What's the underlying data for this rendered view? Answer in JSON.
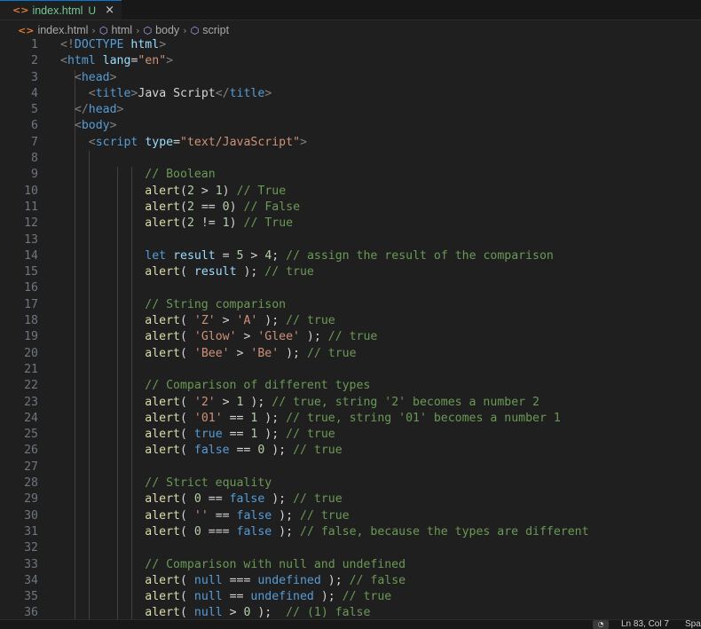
{
  "tab": {
    "icon": "html-file-icon",
    "name": "index.html",
    "status": "U",
    "close": "×"
  },
  "breadcrumbs": [
    "index.html",
    "html",
    "body",
    "script"
  ],
  "editor": {
    "lines": [
      [
        [
          "br",
          "<!"
        ],
        [
          "tag",
          "DOCTYPE"
        ],
        [
          "txt",
          " "
        ],
        [
          "attr",
          "html"
        ],
        [
          "br",
          ">"
        ]
      ],
      [
        [
          "br",
          "<"
        ],
        [
          "tag",
          "html"
        ],
        [
          "txt",
          " "
        ],
        [
          "attr",
          "lang"
        ],
        [
          "txt",
          "="
        ],
        [
          "str",
          "\"en\""
        ],
        [
          "br",
          ">"
        ]
      ],
      [
        [
          "txt",
          "  "
        ],
        [
          "br",
          "<"
        ],
        [
          "tag",
          "head"
        ],
        [
          "br",
          ">"
        ]
      ],
      [
        [
          "txt",
          "    "
        ],
        [
          "br",
          "<"
        ],
        [
          "tag",
          "title"
        ],
        [
          "br",
          ">"
        ],
        [
          "txt",
          "Java Script"
        ],
        [
          "br",
          "</"
        ],
        [
          "tag",
          "title"
        ],
        [
          "br",
          ">"
        ]
      ],
      [
        [
          "txt",
          "  "
        ],
        [
          "br",
          "</"
        ],
        [
          "tag",
          "head"
        ],
        [
          "br",
          ">"
        ]
      ],
      [
        [
          "txt",
          "  "
        ],
        [
          "br",
          "<"
        ],
        [
          "tag",
          "body"
        ],
        [
          "br",
          ">"
        ]
      ],
      [
        [
          "txt",
          "    "
        ],
        [
          "br",
          "<"
        ],
        [
          "tag",
          "script"
        ],
        [
          "txt",
          " "
        ],
        [
          "attr",
          "type"
        ],
        [
          "txt",
          "="
        ],
        [
          "str",
          "\"text/JavaScript\""
        ],
        [
          "br",
          ">"
        ]
      ],
      [],
      [
        [
          "txt",
          "            "
        ],
        [
          "cm",
          "// Boolean"
        ]
      ],
      [
        [
          "txt",
          "            "
        ],
        [
          "fn",
          "alert"
        ],
        [
          "txt",
          "("
        ],
        [
          "num",
          "2"
        ],
        [
          "txt",
          " > "
        ],
        [
          "num",
          "1"
        ],
        [
          "txt",
          ") "
        ],
        [
          "cm",
          "// True"
        ]
      ],
      [
        [
          "txt",
          "            "
        ],
        [
          "fn",
          "alert"
        ],
        [
          "txt",
          "("
        ],
        [
          "num",
          "2"
        ],
        [
          "txt",
          " == "
        ],
        [
          "num",
          "0"
        ],
        [
          "txt",
          ") "
        ],
        [
          "cm",
          "// False"
        ]
      ],
      [
        [
          "txt",
          "            "
        ],
        [
          "fn",
          "alert"
        ],
        [
          "txt",
          "("
        ],
        [
          "num",
          "2"
        ],
        [
          "txt",
          " != "
        ],
        [
          "num",
          "1"
        ],
        [
          "txt",
          ") "
        ],
        [
          "cm",
          "// True"
        ]
      ],
      [],
      [
        [
          "txt",
          "            "
        ],
        [
          "kw",
          "let"
        ],
        [
          "txt",
          " "
        ],
        [
          "var",
          "result"
        ],
        [
          "txt",
          " = "
        ],
        [
          "num",
          "5"
        ],
        [
          "txt",
          " > "
        ],
        [
          "num",
          "4"
        ],
        [
          "txt",
          "; "
        ],
        [
          "cm",
          "// assign the result of the comparison"
        ]
      ],
      [
        [
          "txt",
          "            "
        ],
        [
          "fn",
          "alert"
        ],
        [
          "txt",
          "( "
        ],
        [
          "var",
          "result"
        ],
        [
          "txt",
          " ); "
        ],
        [
          "cm",
          "// true"
        ]
      ],
      [],
      [
        [
          "txt",
          "            "
        ],
        [
          "cm",
          "// String comparison"
        ]
      ],
      [
        [
          "txt",
          "            "
        ],
        [
          "fn",
          "alert"
        ],
        [
          "txt",
          "( "
        ],
        [
          "str",
          "'Z'"
        ],
        [
          "txt",
          " > "
        ],
        [
          "str",
          "'A'"
        ],
        [
          "txt",
          " ); "
        ],
        [
          "cm",
          "// true"
        ]
      ],
      [
        [
          "txt",
          "            "
        ],
        [
          "fn",
          "alert"
        ],
        [
          "txt",
          "( "
        ],
        [
          "str",
          "'Glow'"
        ],
        [
          "txt",
          " > "
        ],
        [
          "str",
          "'Glee'"
        ],
        [
          "txt",
          " ); "
        ],
        [
          "cm",
          "// true"
        ]
      ],
      [
        [
          "txt",
          "            "
        ],
        [
          "fn",
          "alert"
        ],
        [
          "txt",
          "( "
        ],
        [
          "str",
          "'Bee'"
        ],
        [
          "txt",
          " > "
        ],
        [
          "str",
          "'Be'"
        ],
        [
          "txt",
          " ); "
        ],
        [
          "cm",
          "// true"
        ]
      ],
      [],
      [
        [
          "txt",
          "            "
        ],
        [
          "cm",
          "// Comparison of different types"
        ]
      ],
      [
        [
          "txt",
          "            "
        ],
        [
          "fn",
          "alert"
        ],
        [
          "txt",
          "( "
        ],
        [
          "str",
          "'2'"
        ],
        [
          "txt",
          " > "
        ],
        [
          "num",
          "1"
        ],
        [
          "txt",
          " ); "
        ],
        [
          "cm",
          "// true, string '2' becomes a number 2"
        ]
      ],
      [
        [
          "txt",
          "            "
        ],
        [
          "fn",
          "alert"
        ],
        [
          "txt",
          "( "
        ],
        [
          "str",
          "'01'"
        ],
        [
          "txt",
          " == "
        ],
        [
          "num",
          "1"
        ],
        [
          "txt",
          " ); "
        ],
        [
          "cm",
          "// true, string '01' becomes a number 1"
        ]
      ],
      [
        [
          "txt",
          "            "
        ],
        [
          "fn",
          "alert"
        ],
        [
          "txt",
          "( "
        ],
        [
          "kw",
          "true"
        ],
        [
          "txt",
          " == "
        ],
        [
          "num",
          "1"
        ],
        [
          "txt",
          " ); "
        ],
        [
          "cm",
          "// true"
        ]
      ],
      [
        [
          "txt",
          "            "
        ],
        [
          "fn",
          "alert"
        ],
        [
          "txt",
          "( "
        ],
        [
          "kw",
          "false"
        ],
        [
          "txt",
          " == "
        ],
        [
          "num",
          "0"
        ],
        [
          "txt",
          " ); "
        ],
        [
          "cm",
          "// true"
        ]
      ],
      [],
      [
        [
          "txt",
          "            "
        ],
        [
          "cm",
          "// Strict equality"
        ]
      ],
      [
        [
          "txt",
          "            "
        ],
        [
          "fn",
          "alert"
        ],
        [
          "txt",
          "( "
        ],
        [
          "num",
          "0"
        ],
        [
          "txt",
          " == "
        ],
        [
          "kw",
          "false"
        ],
        [
          "txt",
          " ); "
        ],
        [
          "cm",
          "// true"
        ]
      ],
      [
        [
          "txt",
          "            "
        ],
        [
          "fn",
          "alert"
        ],
        [
          "txt",
          "( "
        ],
        [
          "str",
          "''"
        ],
        [
          "txt",
          " == "
        ],
        [
          "kw",
          "false"
        ],
        [
          "txt",
          " ); "
        ],
        [
          "cm",
          "// true"
        ]
      ],
      [
        [
          "txt",
          "            "
        ],
        [
          "fn",
          "alert"
        ],
        [
          "txt",
          "( "
        ],
        [
          "num",
          "0"
        ],
        [
          "txt",
          " === "
        ],
        [
          "kw",
          "false"
        ],
        [
          "txt",
          " ); "
        ],
        [
          "cm",
          "// false, because the types are different"
        ]
      ],
      [],
      [
        [
          "txt",
          "            "
        ],
        [
          "cm",
          "// Comparison with null and undefined"
        ]
      ],
      [
        [
          "txt",
          "            "
        ],
        [
          "fn",
          "alert"
        ],
        [
          "txt",
          "( "
        ],
        [
          "kw",
          "null"
        ],
        [
          "txt",
          " === "
        ],
        [
          "kw",
          "undefined"
        ],
        [
          "txt",
          " ); "
        ],
        [
          "cm",
          "// false"
        ]
      ],
      [
        [
          "txt",
          "            "
        ],
        [
          "fn",
          "alert"
        ],
        [
          "txt",
          "( "
        ],
        [
          "kw",
          "null"
        ],
        [
          "txt",
          " == "
        ],
        [
          "kw",
          "undefined"
        ],
        [
          "txt",
          " ); "
        ],
        [
          "cm",
          "// true"
        ]
      ],
      [
        [
          "txt",
          "            "
        ],
        [
          "fn",
          "alert"
        ],
        [
          "txt",
          "( "
        ],
        [
          "kw",
          "null"
        ],
        [
          "txt",
          " > "
        ],
        [
          "num",
          "0"
        ],
        [
          "txt",
          " );  "
        ],
        [
          "cm",
          "// (1) false"
        ]
      ]
    ]
  },
  "statusbar": {
    "bell_icon": "bell-icon",
    "position": "Ln 83, Col 7",
    "spaces": "Spa"
  }
}
